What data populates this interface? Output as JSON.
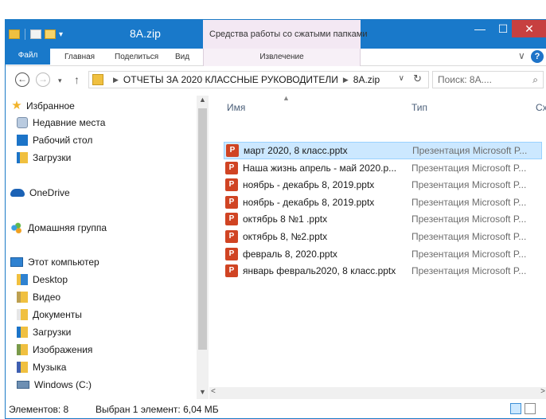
{
  "window": {
    "title": "8A.zip",
    "context_tab_group": "Средства работы со сжатыми папками",
    "controls": {
      "minimize": "—",
      "maximize": "☐",
      "close": "✕"
    }
  },
  "ribbon": {
    "tabs": [
      {
        "label": "Файл"
      },
      {
        "label": "Главная"
      },
      {
        "label": "Поделиться"
      },
      {
        "label": "Вид"
      },
      {
        "label": "Извлечение"
      }
    ],
    "help": "?"
  },
  "address": {
    "segments": [
      "ОТЧЕТЫ ЗА 2020 КЛАССНЫЕ РУКОВОДИТЕЛИ",
      "8A.zip"
    ],
    "search_placeholder": "Поиск: 8A...."
  },
  "navigation": {
    "favorites": "Избранное",
    "favorites_items": [
      "Недавние места",
      "Рабочий стол",
      "Загрузки"
    ],
    "onedrive": "OneDrive",
    "homegroup": "Домашняя группа",
    "this_pc": "Этот компьютер",
    "pc_items": [
      "Desktop",
      "Видео",
      "Документы",
      "Загрузки",
      "Изображения",
      "Музыка",
      "Windows (C:)"
    ]
  },
  "columns": {
    "name": "Имя",
    "type": "Тип",
    "cx": "Сх"
  },
  "files": [
    {
      "name": "март 2020, 8 класс.pptx",
      "type": "Презентация Microsoft P...",
      "selected": true
    },
    {
      "name": "Наша жизнь апрель - май 2020.p...",
      "type": "Презентация Microsoft P...",
      "selected": false
    },
    {
      "name": "ноябрь  - декабрь 8, 2019.pptx",
      "type": "Презентация Microsoft P...",
      "selected": false
    },
    {
      "name": "ноябрь  - декабрь 8, 2019.pptx",
      "type": "Презентация Microsoft P...",
      "selected": false
    },
    {
      "name": "октябрь 8 №1 .pptx",
      "type": "Презентация Microsoft P...",
      "selected": false
    },
    {
      "name": "октябрь 8, №2.pptx",
      "type": "Презентация Microsoft P...",
      "selected": false
    },
    {
      "name": "февраль 8, 2020.pptx",
      "type": "Презентация Microsoft P...",
      "selected": false
    },
    {
      "name": "январь февраль2020, 8 класс.pptx",
      "type": "Презентация Microsoft P...",
      "selected": false
    }
  ],
  "status": {
    "count": "Элементов: 8",
    "selection": "Выбран 1 элемент: 6,04 МБ"
  },
  "colors": {
    "titlebar": "#1979ca",
    "close_button": "#c74040",
    "selection": "#cce8ff",
    "ppt_icon": "#d04423"
  }
}
